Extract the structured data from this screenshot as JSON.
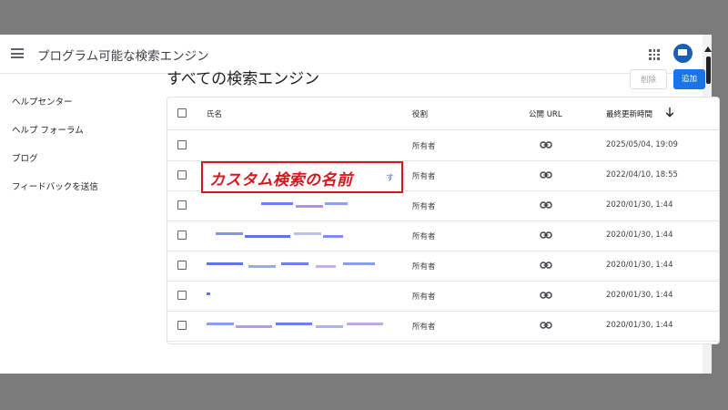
{
  "app_bar": {
    "title": "プログラム可能な検索エンジン"
  },
  "sidebar": {
    "items": [
      "ヘルプセンター",
      "ヘルプ フォーラム",
      "ブログ",
      "フィードバックを送信"
    ]
  },
  "main": {
    "title": "すべての検索エンジン",
    "delete_label": "削除",
    "add_label": "追加"
  },
  "table": {
    "columns": [
      "氏名",
      "役割",
      "公開 URL",
      "最終更新時間"
    ],
    "rows": [
      {
        "role": "所有者",
        "updated": "2025/05/04, 19:09"
      },
      {
        "role": "所有者",
        "updated": "2022/04/10, 18:55"
      },
      {
        "role": "所有者",
        "updated": "2020/01/30, 1:44"
      },
      {
        "role": "所有者",
        "updated": "2020/01/30, 1:44"
      },
      {
        "role": "所有者",
        "updated": "2020/01/30, 1:44"
      },
      {
        "role": "所有者",
        "updated": "2020/01/30, 1:44"
      },
      {
        "role": "所有者",
        "updated": "2020/01/30, 1:44"
      }
    ]
  },
  "annotation": {
    "text": "カスタム検索の名前",
    "tail": "す",
    "color": "#d6161c"
  },
  "colors": {
    "accent": "#1a73e8",
    "avatar": "#1a5fb4"
  },
  "icons": {
    "menu": "menu-icon",
    "apps": "apps-grid-icon",
    "link": "link-icon",
    "sort": "arrow-down-icon"
  }
}
